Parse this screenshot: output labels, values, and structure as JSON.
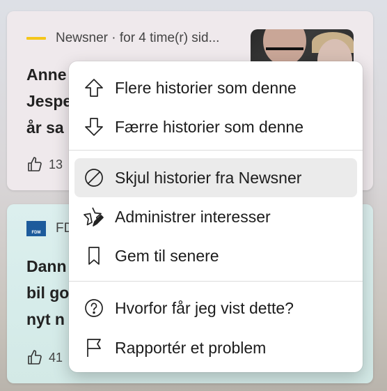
{
  "cards": [
    {
      "source": "Newsner · for 4 time(r) sid...",
      "headline_lines": [
        "Anne",
        "Jespe",
        "år sa"
      ],
      "likes": "13",
      "logo_color": "#f5c61a"
    },
    {
      "source": "FD",
      "logo_text": "FDM",
      "headline_lines": [
        "Dann",
        "bil go",
        "nyt n"
      ],
      "likes": "41",
      "logo_color": "#1d5b9c"
    }
  ],
  "menu": {
    "items": [
      {
        "label": "Flere historier som denne",
        "icon": "arrow-up-icon"
      },
      {
        "label": "Færre historier som denne",
        "icon": "arrow-down-icon"
      },
      {
        "label": "Skjul historier fra Newsner",
        "icon": "block-icon",
        "highlighted": true
      },
      {
        "label": "Administrer interesser",
        "icon": "star-edit-icon"
      },
      {
        "label": "Gem til senere",
        "icon": "bookmark-icon"
      },
      {
        "label": "Hvorfor får jeg vist dette?",
        "icon": "help-icon"
      },
      {
        "label": "Rapportér et problem",
        "icon": "flag-icon"
      }
    ]
  }
}
